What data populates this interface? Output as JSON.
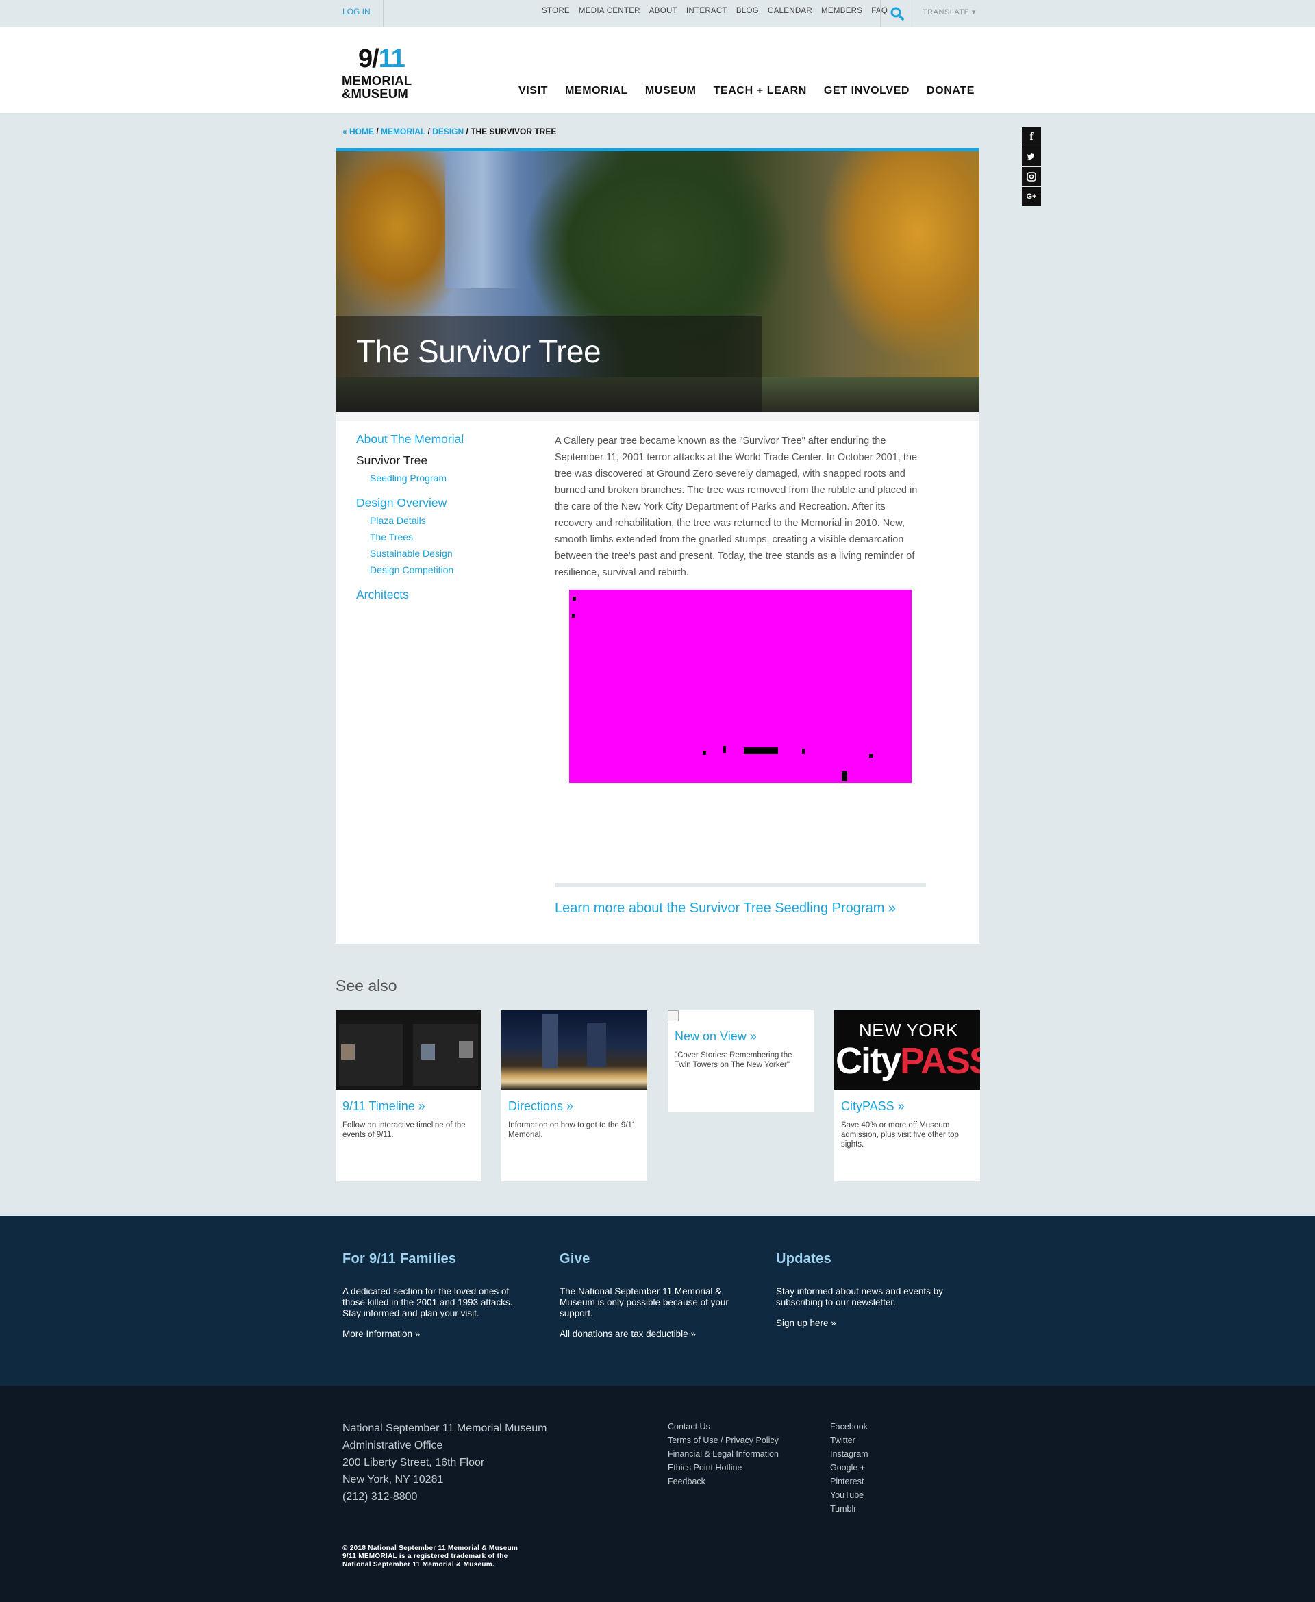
{
  "utility": {
    "login": "LOG IN",
    "links": [
      "STORE",
      "MEDIA CENTER",
      "ABOUT",
      "INTERACT",
      "BLOG",
      "CALENDAR",
      "MEMBERS",
      "FAQ"
    ],
    "translate": "TRANSLATE ▾"
  },
  "logo": {
    "number_left": "9/",
    "number_right": "11",
    "line1": "MEMORIAL",
    "line2": "&MUSEUM"
  },
  "nav": [
    "VISIT",
    "MEMORIAL",
    "MUSEUM",
    "TEACH + LEARN",
    "GET INVOLVED",
    "DONATE"
  ],
  "breadcrumb": {
    "home": "« HOME",
    "memorial": "MEMORIAL",
    "design": "DESIGN",
    "current": "THE SURVIVOR TREE",
    "sep": " / "
  },
  "social": [
    "f",
    "t",
    "ig",
    "G+"
  ],
  "hero": {
    "title": "The Survivor Tree"
  },
  "sidebar": {
    "about": "About The Memorial",
    "current": "Survivor Tree",
    "seedling": "Seedling Program",
    "design": "Design Overview",
    "design_items": [
      "Plaza Details",
      "The Trees",
      "Sustainable Design",
      "Design Competition"
    ],
    "architects": "Architects"
  },
  "article": {
    "body": "A Callery pear tree became known as the \"Survivor Tree\" after enduring the September 11, 2001 terror attacks at the World Trade Center. In October 2001, the tree was discovered at Ground Zero severely damaged, with snapped roots and burned and broken branches. The tree was removed from the rubble and placed in the care of the New York City Department of Parks and Recreation. After its recovery and rehabilitation, the tree was returned to the Memorial in 2010. New, smooth limbs extended from the gnarled stumps, creating a visible demarcation between the tree's past and present. Today, the tree stands as a living reminder of resilience, survival and rebirth.",
    "learn_more": "Learn more about the Survivor Tree Seedling Program »"
  },
  "see_also": {
    "heading": "See also",
    "cards": [
      {
        "title": "9/11 Timeline »",
        "desc": "Follow an interactive timeline of the events of 9/11."
      },
      {
        "title": "Directions »",
        "desc": "Information on how to get to the 9/11 Memorial."
      },
      {
        "title": "New on View »",
        "desc": "\"Cover Stories: Remembering the Twin Towers on The New Yorker\""
      },
      {
        "title": "CityPASS »",
        "desc": "Save 40% or more off Museum admission, plus visit five other top sights.",
        "img_line1": "NEW YORK",
        "img_city": "City",
        "img_pass": "PASS"
      }
    ]
  },
  "families": {
    "cols": [
      {
        "title": "For 9/11 Families",
        "text": "A dedicated section for the loved ones of those killed in the 2001 and 1993 attacks. Stay informed and plan your visit.",
        "link": "More Information »"
      },
      {
        "title": "Give",
        "text": "The National September 11 Memorial & Museum is only possible because of your support.",
        "link": "All donations are tax deductible »"
      },
      {
        "title": "Updates",
        "text": "Stay informed about news and events by subscribing to our newsletter.",
        "link": "Sign up here »"
      }
    ]
  },
  "footer": {
    "address": [
      "National September 11 Memorial Museum",
      "Administrative Office",
      "200 Liberty Street, 16th Floor",
      "New York, NY 10281",
      "(212) 312-8800"
    ],
    "links1": [
      "Contact Us",
      "Terms of Use / Privacy Policy",
      "Financial & Legal Information",
      "Ethics Point Hotline",
      "Feedback"
    ],
    "links2": [
      "Facebook",
      "Twitter",
      "Instagram",
      "Google +",
      "Pinterest",
      "YouTube",
      "Tumblr"
    ],
    "copyright": [
      "© 2018 National September 11 Memorial & Museum",
      "9/11 MEMORIAL is a registered trademark of the",
      "National September 11 Memorial & Museum."
    ]
  },
  "colors": {
    "accent": "#1ca3dc",
    "band": "#0e2940",
    "footer": "#0e1824",
    "page_bg": "#e1e8ec",
    "photo_placeholder": "#ff00ff"
  }
}
